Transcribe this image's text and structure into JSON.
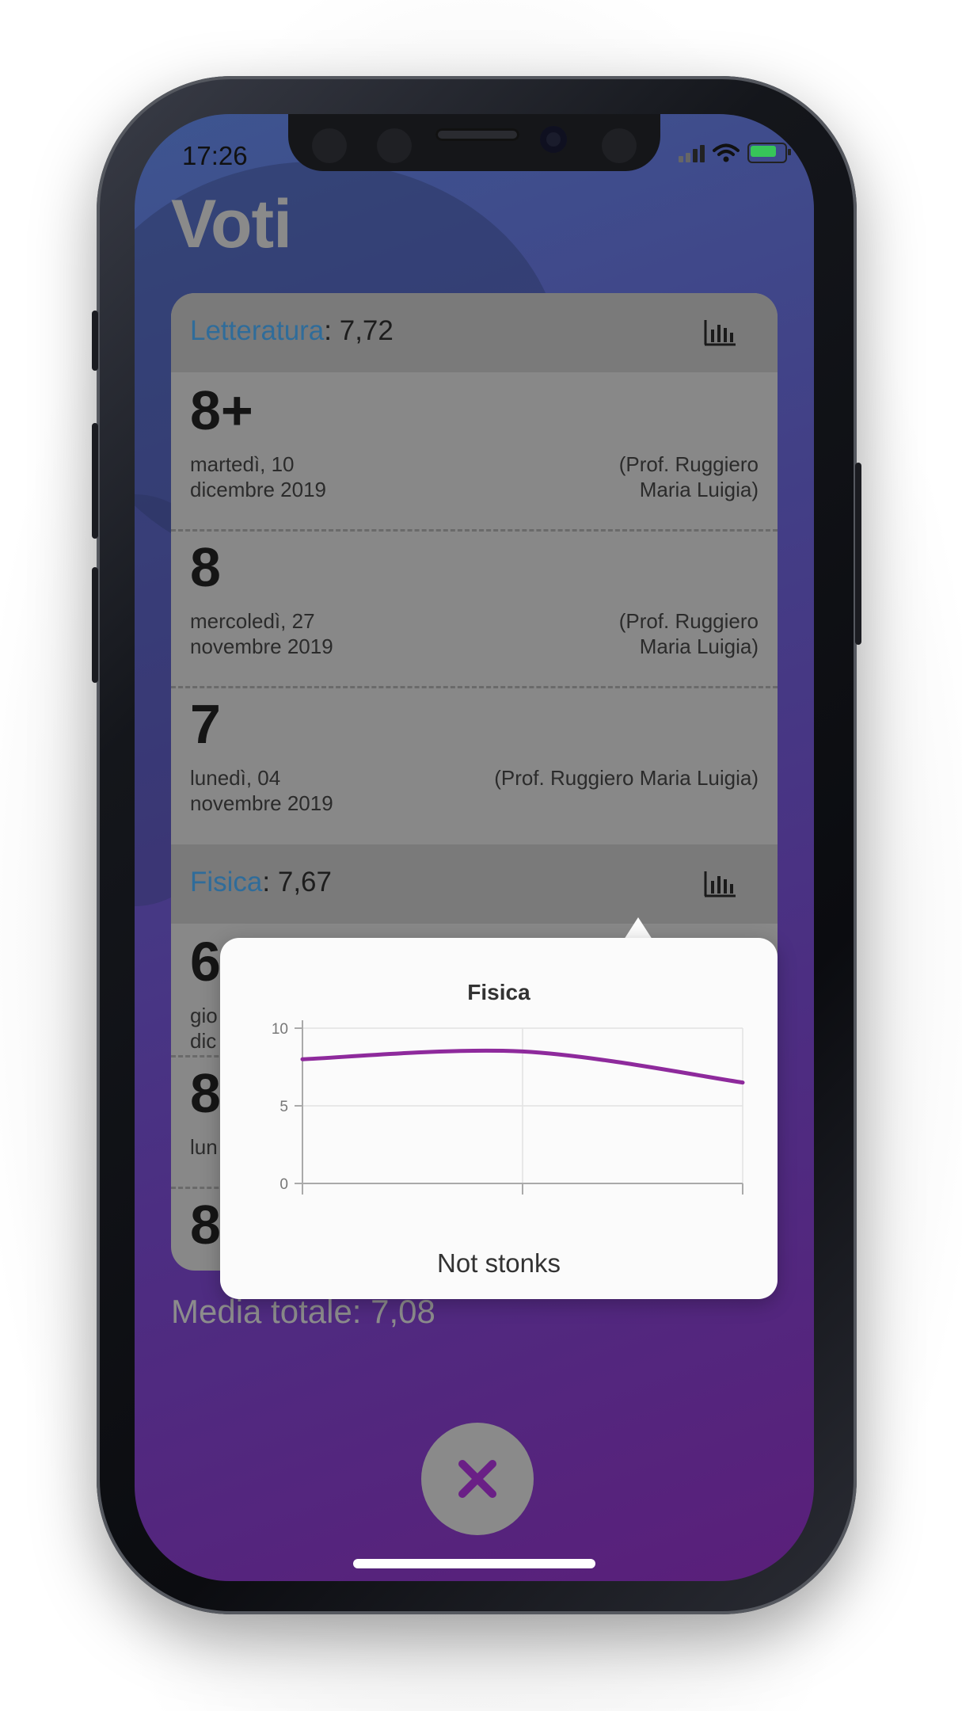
{
  "status": {
    "time": "17:26"
  },
  "page": {
    "title": "Voti"
  },
  "subjects": [
    {
      "name": "Letteratura",
      "average": ": 7,72",
      "grades": [
        {
          "value": "8+",
          "date": "martedì, 10 dicembre 2019",
          "prof": "(Prof. Ruggiero Maria Luigia)"
        },
        {
          "value": "8",
          "date": "mercoledì, 27 novembre 2019",
          "prof": "(Prof. Ruggiero Maria Luigia)"
        },
        {
          "value": "7",
          "date": "lunedì, 04 novembre 2019",
          "prof": "(Prof. Ruggiero Maria Luigia)"
        }
      ]
    },
    {
      "name": "Fisica",
      "average": ": 7,67",
      "grades_partial": [
        {
          "value_fragment": "6",
          "date_fragment": "gio",
          "date_fragment2": "dic"
        },
        {
          "value_fragment": "8",
          "date_fragment": "lun"
        },
        {
          "value_fragment": "8"
        }
      ]
    }
  ],
  "summary": {
    "media_totale": "Media totale: 7,08"
  },
  "popover": {
    "caption": "Not stonks",
    "chart_data": {
      "type": "line",
      "title": "Fisica",
      "xlabel": "",
      "ylabel": "",
      "ylim": [
        0,
        10
      ],
      "yticks": [
        "0",
        "5",
        "10"
      ],
      "x": [
        0,
        1,
        2
      ],
      "series": [
        {
          "values": [
            8,
            8.5,
            6.5
          ],
          "color": "#8e2a9c"
        }
      ],
      "grid": true
    }
  },
  "colors": {
    "accent": "#6a1f86",
    "subject_name": "#2f6c9a"
  },
  "icons": {
    "chart": "bar-chart-icon",
    "close": "close-icon"
  }
}
